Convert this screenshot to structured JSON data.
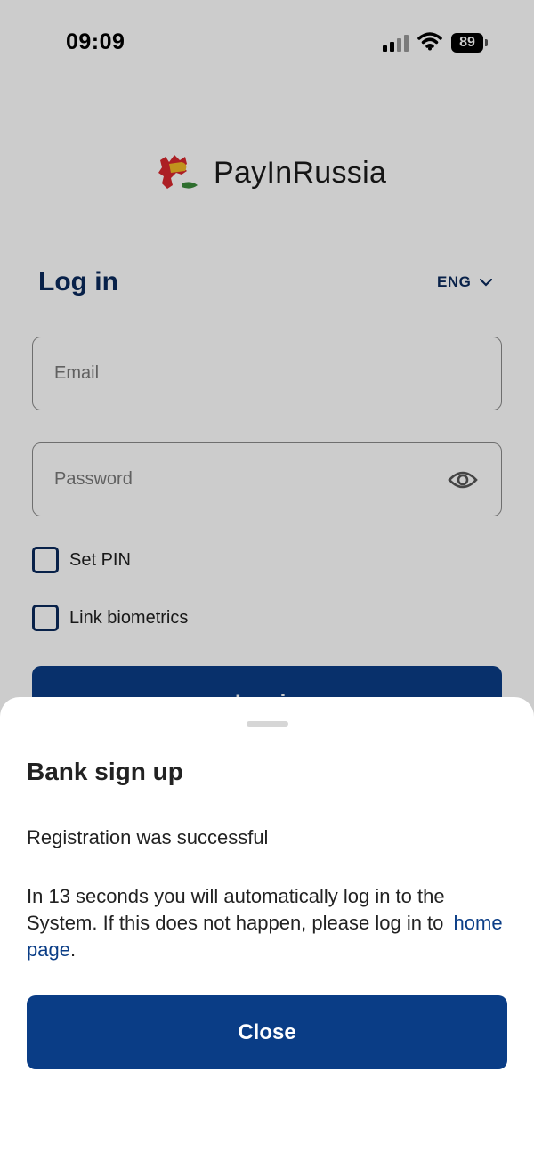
{
  "status_bar": {
    "time": "09:09",
    "battery_level": "89",
    "icons": [
      "signal-icon",
      "wifi-icon",
      "battery-icon"
    ]
  },
  "brand": {
    "name": "PayInRussia",
    "logo_colors": [
      "#d8272e",
      "#f2b825",
      "#3a8a3a"
    ]
  },
  "login": {
    "title": "Log in",
    "language": "ENG",
    "email_placeholder": "Email",
    "password_placeholder": "Password",
    "set_pin_label": "Set PIN",
    "link_biometrics_label": "Link biometrics",
    "login_button_label": "Log in"
  },
  "sheet": {
    "title": "Bank sign up",
    "status": "Registration was successful",
    "message": "In 13 seconds you will automatically log in to the System. If this does not happen, please log in to",
    "link": "home page",
    "message_end": ".",
    "close_button": "Close"
  },
  "colors": {
    "primary": "#0a3d86",
    "heading": "#0a2a5c",
    "overlay": "rgba(0,0,0,0.2)"
  }
}
